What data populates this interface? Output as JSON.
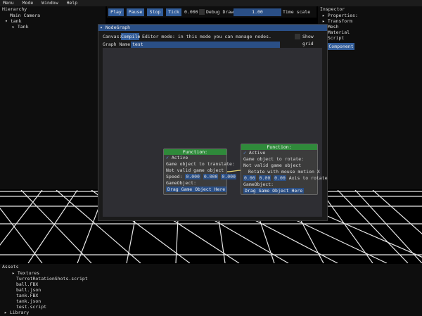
{
  "menu": [
    "Menu",
    "Mode",
    "Window",
    "Help"
  ],
  "hierarchy": {
    "title": "Hierarchy",
    "items": [
      "Main Camera",
      "tank",
      "Tank"
    ]
  },
  "toolbar": {
    "play": "Play",
    "pause": "Pause",
    "stop": "Stop",
    "tick": "Tick",
    "time_value": "0.000",
    "debug_draw": "Debug Draw",
    "time_scale_value": "1.00",
    "time_scale_label": "Time scale"
  },
  "inspector": {
    "title": "Inspector",
    "items": [
      "Properties:",
      "Transform",
      "Mesh",
      "Material",
      "Script"
    ],
    "add_component": "Component"
  },
  "nodegraph": {
    "title": "NodeGraph",
    "canvas_label": "Canvas:",
    "compile": "Compile",
    "mode_text": "Editor mode: in this mode you can manage nodes.",
    "show_grid": "Show grid",
    "graph_name_label": "Graph Name:",
    "graph_name_value": "test"
  },
  "node1": {
    "header": "Function:",
    "active": "Active",
    "label1": "Game object to translate:",
    "label2": "Not valid game object",
    "speed_label": "Speed:",
    "speed_x": "0.000",
    "speed_y": "0.000",
    "speed_z": "0.000",
    "go_label": "GameObject:",
    "drag": "Drag Game Object Here"
  },
  "node2": {
    "header": "Function:",
    "active": "Active",
    "label1": "Game object to rotate:",
    "label2": "Not valid game object",
    "rotate_label": "Rotate with mouse motion X",
    "ax": "0.00",
    "ay": "0.00",
    "az": "0.00",
    "axis_label": "Axis to rotate",
    "go_label": "GameObject:",
    "drag": "Drag Game Object Here"
  },
  "assets": {
    "title": "Assets",
    "items": [
      "Textures",
      "TurretRotationShots.script",
      "ball.FBX",
      "ball.json",
      "tank.FBX",
      "tank.json",
      "test.script",
      "Library"
    ]
  }
}
